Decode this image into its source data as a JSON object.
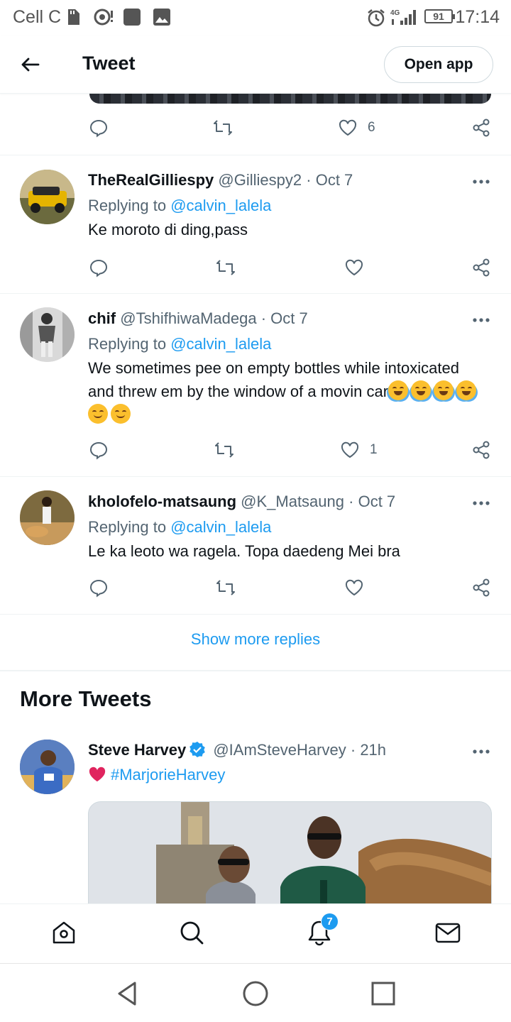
{
  "status_bar": {
    "carrier": "Cell C",
    "network": "4G",
    "battery": "91",
    "time": "17:14"
  },
  "header": {
    "title": "Tweet",
    "open_app_label": "Open app"
  },
  "top_actions": {
    "like_count": "6"
  },
  "replies": [
    {
      "name": "TheRealGilliespy",
      "handle": "@Gilliespy2",
      "date": "Oct 7",
      "replying_prefix": "Replying to",
      "replying_to": "@calvin_lalela",
      "text": "Ke moroto di ding,pass",
      "like_count": ""
    },
    {
      "name": "chif",
      "handle": "@TshifhiwaMadega",
      "date": "Oct 7",
      "replying_prefix": "Replying to",
      "replying_to": "@calvin_lalela",
      "text": "We sometimes pee on empty bottles while intoxicated and threw em by the window of a movin car",
      "emojis": [
        "face-with-tears-of-joy",
        "face-with-tears-of-joy",
        "face-with-tears-of-joy",
        "face-with-tears-of-joy",
        "smiling-face",
        "smiling-face"
      ],
      "like_count": "1"
    },
    {
      "name": "kholofelo-matsaung",
      "handle": "@K_Matsaung",
      "date": "Oct 7",
      "replying_prefix": "Replying to",
      "replying_to": "@calvin_lalela",
      "text": "Le ka leoto wa ragela. Topa daedeng Mei bra",
      "like_count": ""
    }
  ],
  "show_more_label": "Show more replies",
  "more_tweets": {
    "title": "More Tweets",
    "tweet": {
      "name": "Steve Harvey",
      "verified": true,
      "handle": "@IAmSteveHarvey",
      "time": "21h",
      "hashtag": "#MarjorieHarvey",
      "heart_icon": "red-heart-icon"
    }
  },
  "bottom_nav": {
    "items": [
      "home-icon",
      "search-icon",
      "notifications-icon",
      "messages-icon"
    ],
    "notification_badge": "7"
  },
  "colors": {
    "accent": "#1d9bf0",
    "text": "#0f1419",
    "secondary": "#536471",
    "divider": "#eff3f4"
  }
}
